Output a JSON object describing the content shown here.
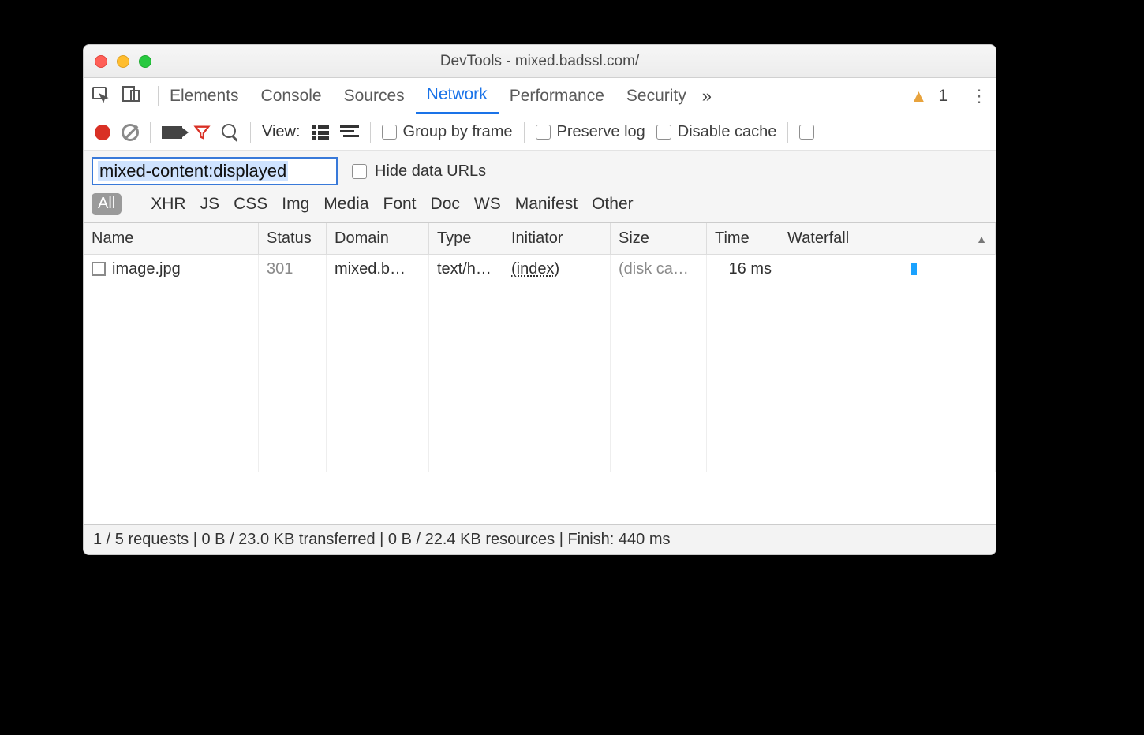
{
  "window": {
    "title": "DevTools - mixed.badssl.com/"
  },
  "tabs": {
    "items": [
      "Elements",
      "Console",
      "Sources",
      "Network",
      "Performance",
      "Security"
    ],
    "active": "Network",
    "warning_count": "1"
  },
  "toolbar": {
    "view_label": "View:",
    "group_by_frame": "Group by frame",
    "preserve_log": "Preserve log",
    "disable_cache": "Disable cache"
  },
  "filter": {
    "value": "mixed-content:displayed",
    "hide_data_urls": "Hide data URLs"
  },
  "types": [
    "All",
    "XHR",
    "JS",
    "CSS",
    "Img",
    "Media",
    "Font",
    "Doc",
    "WS",
    "Manifest",
    "Other"
  ],
  "types_active": "All",
  "columns": [
    "Name",
    "Status",
    "Domain",
    "Type",
    "Initiator",
    "Size",
    "Time",
    "Waterfall"
  ],
  "rows": [
    {
      "name": "image.jpg",
      "status": "301",
      "domain": "mixed.b…",
      "type": "text/h…",
      "initiator": "(index)",
      "size": "(disk ca…",
      "time": "16 ms"
    }
  ],
  "status": "1 / 5 requests | 0 B / 23.0 KB transferred | 0 B / 22.4 KB resources | Finish: 440 ms"
}
